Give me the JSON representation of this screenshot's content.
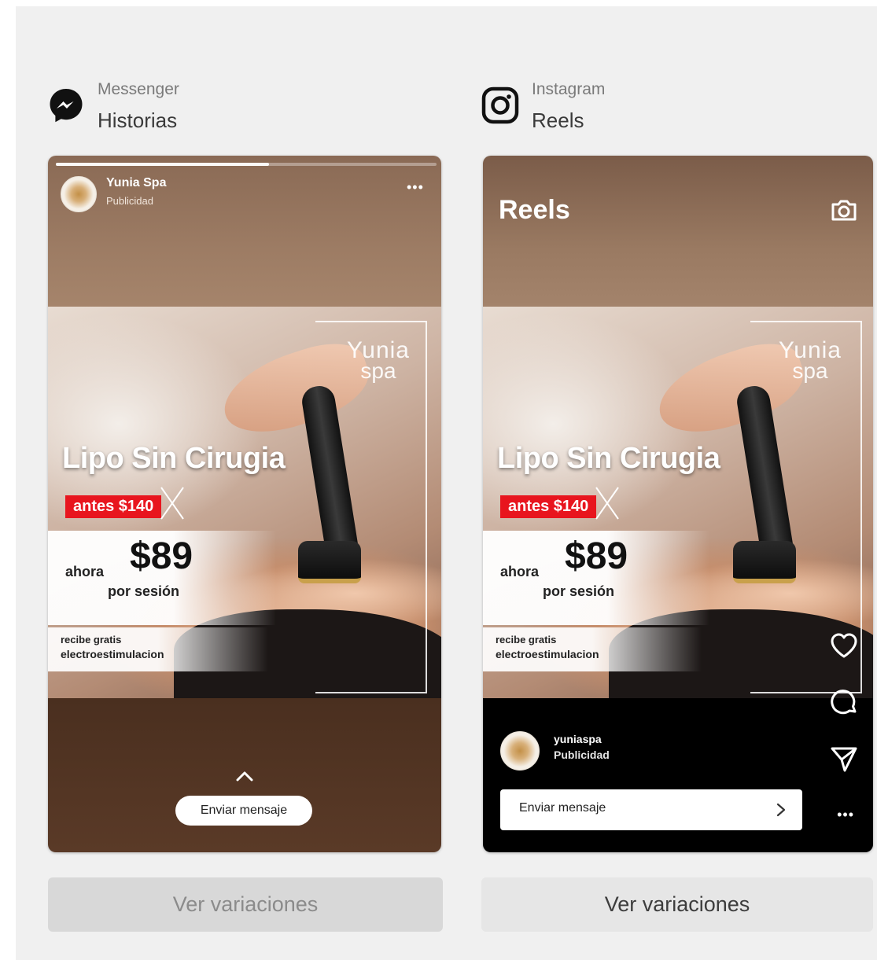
{
  "colors": {
    "background": "#f0f0f0",
    "sale_badge": "#e8151e",
    "button_disabled": "#d8d8d8",
    "button": "#e6e6e6"
  },
  "placements": [
    {
      "platform": "Messenger",
      "format": "Historias",
      "platform_icon": "messenger-icon",
      "advertiser": "Yunia Spa",
      "sponsored_label": "Publicidad",
      "cta_label": "Enviar mensaje",
      "variations_button": "Ver variaciones",
      "variations_enabled": false,
      "story_progress": 0.56
    },
    {
      "platform": "Instagram",
      "format": "Reels",
      "platform_icon": "instagram-icon",
      "screen_title": "Reels",
      "advertiser": "yuniaspa",
      "sponsored_label": "Publicidad",
      "cta_label": "Enviar mensaje",
      "variations_button": "Ver variaciones",
      "variations_enabled": true,
      "side_icons": [
        "heart-icon",
        "comment-icon",
        "share-icon",
        "more-icon"
      ]
    }
  ],
  "creative": {
    "logo_line1": "Yunia",
    "logo_line2": "spa",
    "headline": "Lipo Sin Cirugia",
    "before_price": "antes $140",
    "now_label": "ahora",
    "price": "$89",
    "per_session": "por sesión",
    "bonus_line1": "recibe gratis",
    "bonus_line2": "electroestimulacion"
  }
}
